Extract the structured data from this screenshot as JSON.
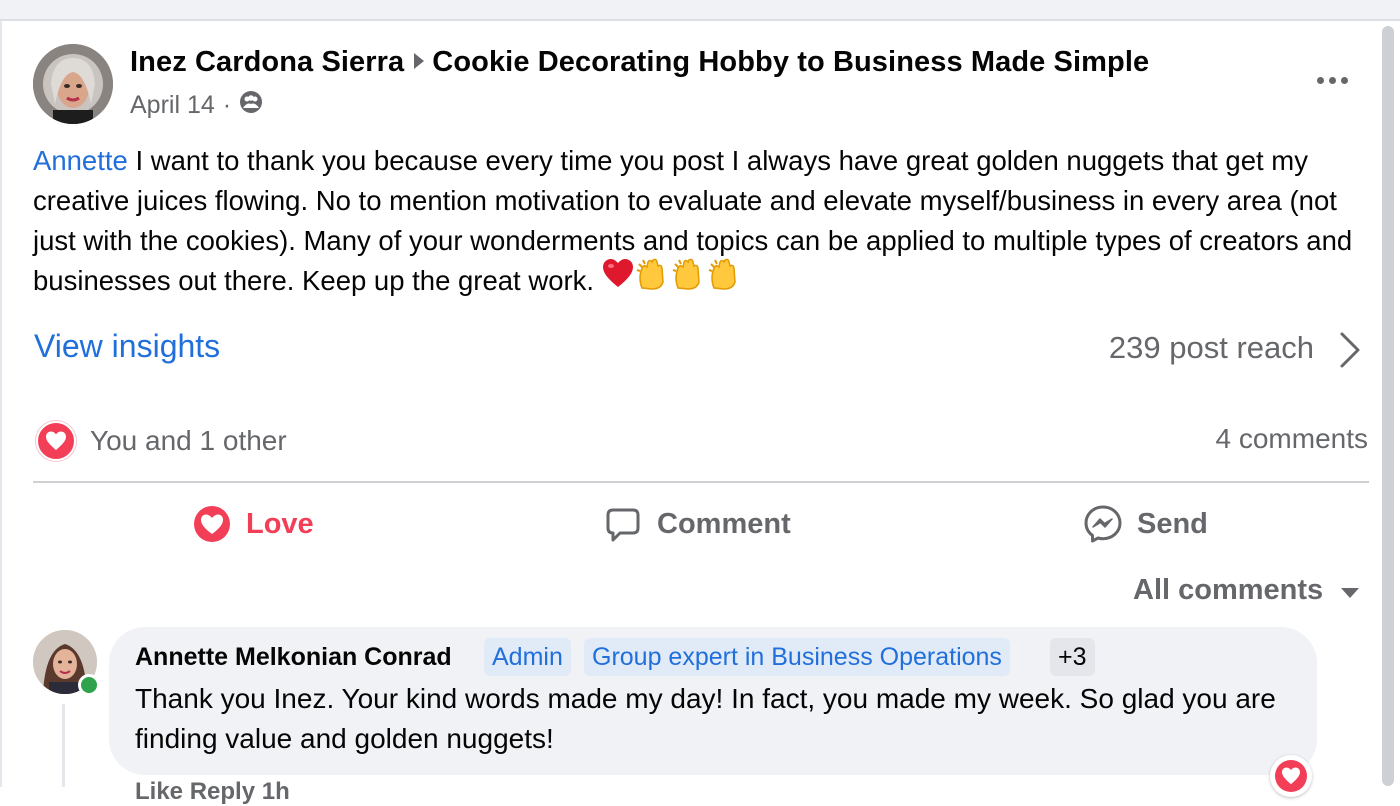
{
  "post": {
    "author": "Inez Cardona Sierra",
    "group": "Cookie Decorating Hobby to Business Made Simple",
    "date": "April 14",
    "separator": "·",
    "privacy_icon": "group-icon",
    "mention": "Annette",
    "body": " I want to thank you because every time you post I always have great golden nuggets that get my creative juices flowing.  No to mention motivation to evaluate and elevate myself/business in every area (not just with the cookies). Many of your wonderments and topics can be applied to multiple types of creators and businesses out there. Keep up the great work. ",
    "emojis": [
      "red-heart",
      "clapping-hands",
      "clapping-hands",
      "clapping-hands"
    ]
  },
  "insights": {
    "link_label": "View insights",
    "reach_label": "239 post reach"
  },
  "reactions": {
    "summary": "You and 1 other",
    "comments_count": "4 comments"
  },
  "actions": {
    "love_label": "Love",
    "comment_label": "Comment",
    "send_label": "Send"
  },
  "comments_filter": {
    "label": "All comments"
  },
  "comment": {
    "author": "Annette Melkonian Conrad",
    "badges": [
      "Admin",
      "Group expert in Business Operations",
      "+3"
    ],
    "text": "Thank you Inez. Your kind words made my day! In fact, you made my week. So glad you are finding value and golden nuggets!",
    "cut_text": "Like   Reply   1h"
  },
  "colors": {
    "link_blue": "#216fdb",
    "love_red": "#f33e58",
    "secondary_text": "#65676b",
    "bubble_bg": "#f0f2f5"
  }
}
